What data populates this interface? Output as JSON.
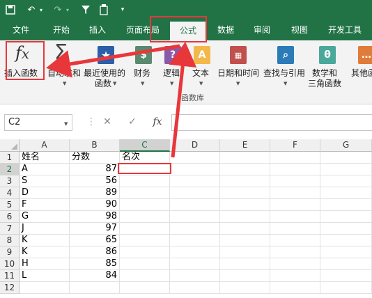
{
  "ribbon_tabs": [
    {
      "label": "文件"
    },
    {
      "label": "开始"
    },
    {
      "label": "插入"
    },
    {
      "label": "页面布局"
    },
    {
      "label": "公式"
    },
    {
      "label": "数据"
    },
    {
      "label": "审阅"
    },
    {
      "label": "视图"
    },
    {
      "label": "开发工具"
    }
  ],
  "active_tab": "公式",
  "ribbon_buttons": {
    "insert_function": "插入函数",
    "autosum": "自动求和",
    "recent_1": "最近使用的",
    "recent_2": "函数",
    "financial": "财务",
    "logical": "逻辑",
    "text": "文本",
    "datetime": "日期和时间",
    "lookup": "查找与引用",
    "math_1": "数学和",
    "math_2": "三角函数",
    "other": "其他函"
  },
  "group_label": "函数库",
  "formula_bar": {
    "name_box": "C2",
    "fx": "fx",
    "cancel": "✕",
    "enter": "✓",
    "value": ""
  },
  "columns": [
    "A",
    "B",
    "C",
    "D",
    "E",
    "F",
    "G"
  ],
  "rows": [
    "1",
    "2",
    "3",
    "4",
    "5",
    "6",
    "7",
    "8",
    "9",
    "10",
    "11",
    "12"
  ],
  "sheet": {
    "headers": {
      "A": "姓名",
      "B": "分数",
      "C": "名次"
    },
    "records": [
      {
        "name": "A",
        "score": "87"
      },
      {
        "name": "S",
        "score": "56"
      },
      {
        "name": "D",
        "score": "89"
      },
      {
        "name": "F",
        "score": "90"
      },
      {
        "name": "G",
        "score": "98"
      },
      {
        "name": "J",
        "score": "97"
      },
      {
        "name": "K",
        "score": "65"
      },
      {
        "name": "K",
        "score": "86"
      },
      {
        "name": "H",
        "score": "85"
      },
      {
        "name": "L",
        "score": "84"
      }
    ]
  },
  "selected_cell": "C2",
  "colors": {
    "excel_green": "#217346",
    "annotation_red": "#e8373b"
  }
}
